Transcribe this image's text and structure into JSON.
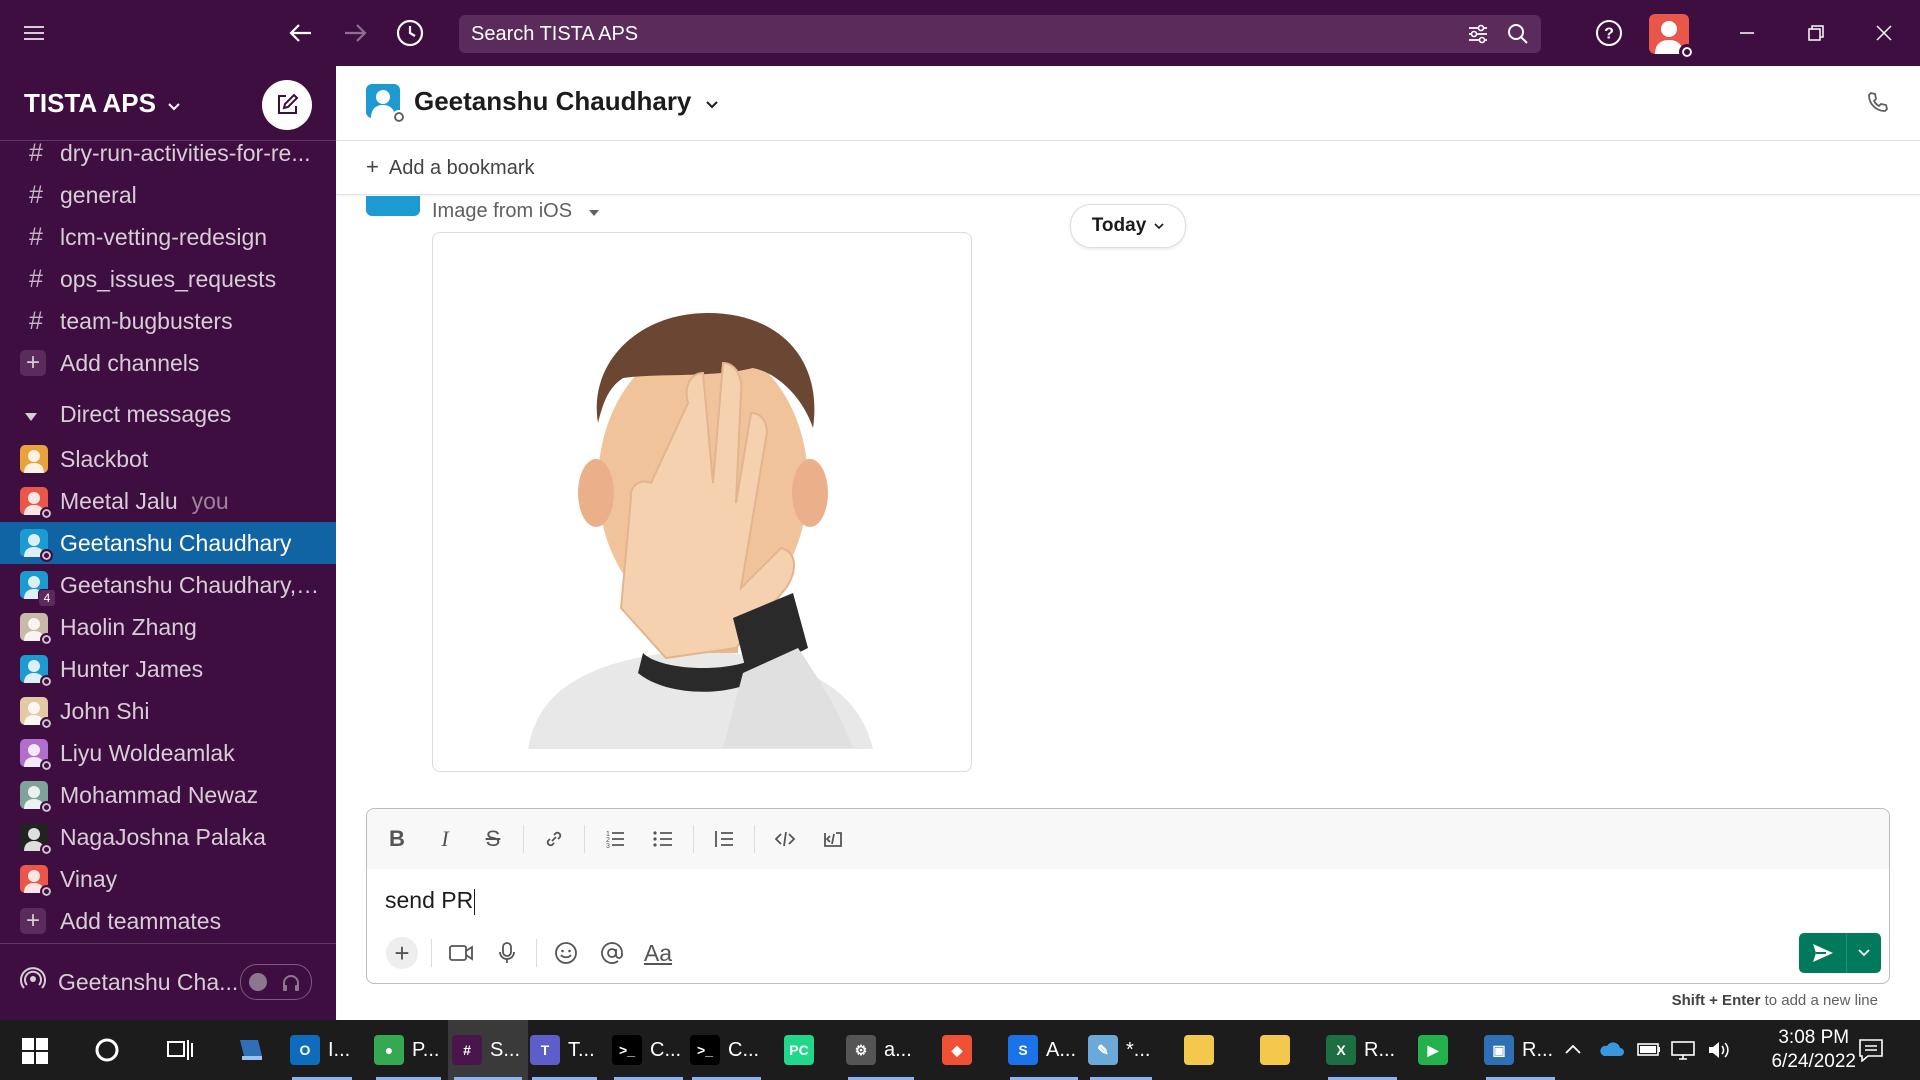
{
  "topbar": {
    "search_placeholder": "Search TISTA APS"
  },
  "workspace": {
    "name": "TISTA APS"
  },
  "channels": [
    {
      "name": "dry-run-activities-for-re..."
    },
    {
      "name": "general"
    },
    {
      "name": "lcm-vetting-redesign"
    },
    {
      "name": "ops_issues_requests"
    },
    {
      "name": "team-bugbusters"
    }
  ],
  "add_channels_label": "Add channels",
  "dm_section_label": "Direct messages",
  "dms": [
    {
      "name": "Slackbot",
      "color": "#e8a33d"
    },
    {
      "name": "Meetal Jalu",
      "suffix": "you",
      "color": "#e8574a"
    },
    {
      "name": "Geetanshu Chaudhary",
      "color": "#1d9bd1"
    },
    {
      "name": "Geetanshu Chaudhary, ...",
      "badge": "4",
      "color": "#1d9bd1"
    },
    {
      "name": "Haolin Zhang",
      "color": "#c8b9a8"
    },
    {
      "name": "Hunter James",
      "color": "#1d9bd1"
    },
    {
      "name": "John Shi",
      "color": "#e5c9a3"
    },
    {
      "name": "Liyu Woldeamlak",
      "color": "#b06fcc"
    },
    {
      "name": "Mohammad Newaz",
      "color": "#7fa39a"
    },
    {
      "name": "NagaJoshna Palaka",
      "color": "#222222"
    },
    {
      "name": "Vinay",
      "color": "#e8574a"
    }
  ],
  "add_teammates_label": "Add teammates",
  "footer_user": "Geetanshu Cha...",
  "channel": {
    "title": "Geetanshu Chaudhary",
    "bookmark_label": "Add a bookmark"
  },
  "message": {
    "file_label": "Image from iOS",
    "date_divider": "Today"
  },
  "composer": {
    "text": "send PR",
    "hint_keys": "Shift + Enter",
    "hint_rest": " to add a new line"
  },
  "taskbar": {
    "items": [
      {
        "label": "I...",
        "icon": "outlook-icon",
        "color": "#0f6cbd",
        "glyph": "O"
      },
      {
        "label": "P...",
        "icon": "chrome-icon",
        "color": "#34a853",
        "glyph": "●"
      },
      {
        "label": "S...",
        "icon": "slack-icon",
        "color": "#4a154b",
        "glyph": "#"
      },
      {
        "label": "T...",
        "icon": "teams-icon",
        "color": "#5b5fc7",
        "glyph": "T"
      },
      {
        "label": "C...",
        "icon": "terminal-icon",
        "color": "#000000",
        "glyph": ">_"
      },
      {
        "label": "C...",
        "icon": "terminal-icon",
        "color": "#000000",
        "glyph": ">_"
      },
      {
        "label": "",
        "icon": "pycharm-icon",
        "color": "#21d789",
        "glyph": "PC"
      },
      {
        "label": "a...",
        "icon": "settings-app-icon",
        "color": "#555555",
        "glyph": "⚙"
      },
      {
        "label": "",
        "icon": "git-icon",
        "color": "#f05033",
        "glyph": "◆"
      },
      {
        "label": "A...",
        "icon": "app-s-icon",
        "color": "#1a73e8",
        "glyph": "S"
      },
      {
        "label": "*...",
        "icon": "notepad-icon",
        "color": "#6aa9d8",
        "glyph": "✎"
      },
      {
        "label": "",
        "icon": "folder-icon",
        "color": "#f2c94c",
        "glyph": ""
      },
      {
        "label": "",
        "icon": "folder-icon",
        "color": "#f2c94c",
        "glyph": ""
      },
      {
        "label": "R...",
        "icon": "excel-icon",
        "color": "#1d6f42",
        "glyph": "X"
      },
      {
        "label": "",
        "icon": "media-player-icon",
        "color": "#22b14c",
        "glyph": "▶"
      },
      {
        "label": "R...",
        "icon": "remote-desktop-icon",
        "color": "#2f6fb5",
        "glyph": "▣"
      }
    ],
    "time": "3:08 PM",
    "date": "6/24/2022"
  }
}
